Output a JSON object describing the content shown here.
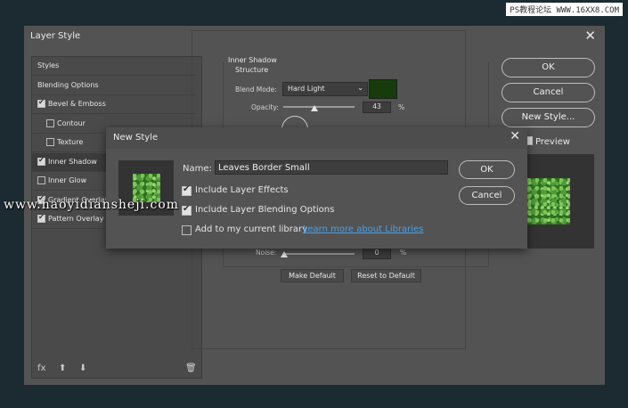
{
  "watermarks": {
    "top_right": "PS教程论坛 WWW.16XX8.COM",
    "overlay": "www.haoyidiansheji.com"
  },
  "layer_style": {
    "title": "Layer Style",
    "close_glyph": "✕",
    "left_panel": {
      "items": [
        {
          "label": "Styles",
          "checkbox": false,
          "checked": false,
          "indent": false,
          "selected": false
        },
        {
          "label": "Blending Options",
          "checkbox": false,
          "checked": false,
          "indent": false,
          "selected": false
        },
        {
          "label": "Bevel & Emboss",
          "checkbox": true,
          "checked": true,
          "indent": false,
          "selected": false
        },
        {
          "label": "Contour",
          "checkbox": true,
          "checked": false,
          "indent": true,
          "selected": false
        },
        {
          "label": "Texture",
          "checkbox": true,
          "checked": false,
          "indent": true,
          "selected": false
        },
        {
          "label": "Inner Shadow",
          "checkbox": true,
          "checked": true,
          "indent": false,
          "selected": true
        },
        {
          "label": "Inner Glow",
          "checkbox": true,
          "checked": false,
          "indent": false,
          "selected": false
        },
        {
          "label": "Gradient Overlay",
          "checkbox": true,
          "checked": true,
          "indent": false,
          "selected": false
        },
        {
          "label": "Pattern Overlay",
          "checkbox": true,
          "checked": true,
          "indent": false,
          "selected": false
        }
      ],
      "footer_icons": {
        "fx": "fx",
        "up": "⬆",
        "down": "⬇",
        "trash": "🗑"
      }
    },
    "center": {
      "group_title": "Inner Shadow",
      "sub_title": "Structure",
      "blend_mode_label": "Blend Mode:",
      "blend_mode_value": "Hard Light",
      "swatch_color": "#163c0c",
      "opacity_label": "Opacity:",
      "opacity_value": "43",
      "opacity_unit": "%",
      "noise_label": "Noise:",
      "noise_value": "0",
      "noise_unit": "%",
      "make_default": "Make Default",
      "reset_default": "Reset to Default"
    },
    "buttons": {
      "ok": "OK",
      "cancel": "Cancel",
      "new_style": "New Style...",
      "preview": "Preview"
    }
  },
  "new_style": {
    "title": "New Style",
    "close_glyph": "✕",
    "name_label": "Name:",
    "name_value": "Leaves Border Small",
    "options": [
      {
        "label": "Include Layer Effects",
        "checked": true
      },
      {
        "label": "Include Layer Blending Options",
        "checked": true
      },
      {
        "label": "Add to my current library",
        "checked": false
      }
    ],
    "link_text": "Learn more about Libraries",
    "ok": "OK",
    "cancel": "Cancel"
  }
}
